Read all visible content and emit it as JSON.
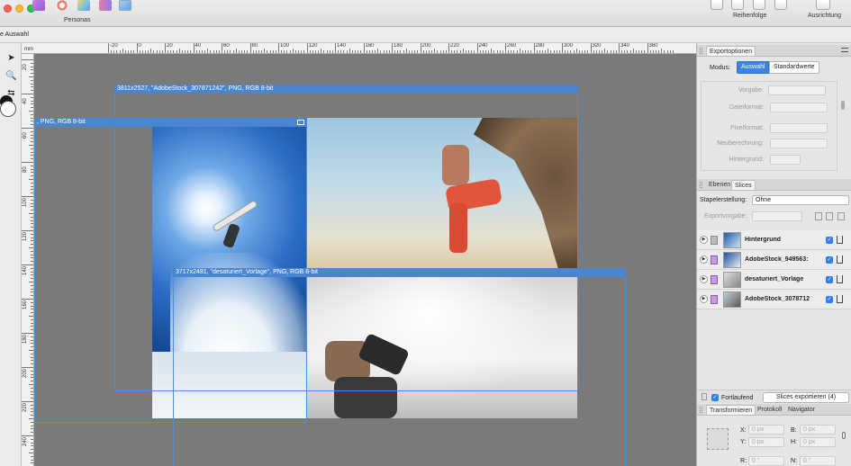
{
  "toolbar": {
    "personas_label": "Personas",
    "reihenfolge_label": "Reihenfolge",
    "ausrichtung_label": "Ausrichtung"
  },
  "context": {
    "selection_text": "e Auswahl"
  },
  "ruler": {
    "unit": "mm",
    "h_ticks": [
      "-20",
      "0",
      "20",
      "40",
      "60",
      "80",
      "100",
      "120",
      "140",
      "160",
      "180",
      "200",
      "220",
      "240",
      "260",
      "280",
      "300",
      "320",
      "340",
      "360"
    ],
    "v_ticks": [
      "20",
      "40",
      "60",
      "80",
      "100",
      "120",
      "140",
      "160",
      "180",
      "200",
      "220",
      "240"
    ]
  },
  "slices": [
    {
      "label": "3811x2527, \"AdobeStock_307871242\", PNG, RGB 8-bit"
    },
    {
      "label": ", PNG, RGB 8-bit"
    },
    {
      "label": "3717x2481, \"desaturiert_Vorlage\", PNG, RGB 8-bit"
    }
  ],
  "export_panel": {
    "tab": "Exportoptionen",
    "modus_label": "Modus:",
    "modus_options": [
      "Auswahl",
      "Standardwerte"
    ],
    "fields": [
      {
        "label": "Vorgabe:"
      },
      {
        "label": "Dateiformat:"
      },
      {
        "label": "Pixelformat:"
      },
      {
        "label": "Neuberechnung:"
      },
      {
        "label": "Hintergrund:"
      }
    ]
  },
  "layers_panel": {
    "tabs": [
      "Ebenen",
      "Slices"
    ],
    "stapel_label": "Stapelerstellung:",
    "stapel_value": "Ohne",
    "exportvorgabe_label": "Exportvorgabe:",
    "rows": [
      {
        "name": "Hintergrund",
        "type": "pixel"
      },
      {
        "name": "AdobeStock_949563:",
        "type": "slice"
      },
      {
        "name": "desaturiert_Vorlage",
        "type": "slice"
      },
      {
        "name": "AdobeStock_3078712",
        "type": "slice"
      }
    ],
    "fortlaufend_label": "Fortlaufend",
    "export_button": "Slices exportieren (4)"
  },
  "transform_panel": {
    "tabs": [
      "Transformieren",
      "Protokoll",
      "Navigator"
    ],
    "fields": [
      {
        "label": "X:",
        "value": "0 px"
      },
      {
        "label": "B:",
        "value": "0 px"
      },
      {
        "label": "Y:",
        "value": "0 px"
      },
      {
        "label": "H:",
        "value": "0 px"
      },
      {
        "label": "R:",
        "value": "0 °"
      },
      {
        "label": "N:",
        "value": "0 °"
      }
    ]
  },
  "colors": {
    "accent": "#3a84e8",
    "slice_frame": "#4d8fd9",
    "canvas_bg": "#7a7a7a"
  }
}
